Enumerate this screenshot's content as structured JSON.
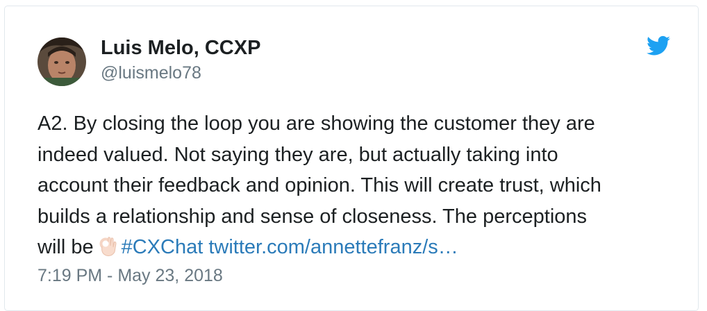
{
  "author": {
    "name": "Luis Melo, CCXP",
    "handle": "@luismelo78",
    "avatar_icon": "profile-photo"
  },
  "tweet": {
    "lines": [
      "A2. By closing the loop you are showing the customer they are",
      "indeed valued. Not saying they are, but actually taking into",
      "account their feedback and opinion. This will create trust, which",
      "builds a relationship and sense of closeness. The perceptions"
    ],
    "last_line_prefix": "will be",
    "emoji_icon": "ok-hand-emoji",
    "hashtag": "#CXChat",
    "link": "twitter.com/annettefranz/s…"
  },
  "timestamp": "7:19 PM - May 23, 2018",
  "brand_icon": "twitter-bird-icon",
  "colors": {
    "text": "#1c2022",
    "muted": "#697882",
    "link": "#2b7bb9",
    "twitter_blue": "#1da1f2",
    "border": "#e1e8ed"
  }
}
